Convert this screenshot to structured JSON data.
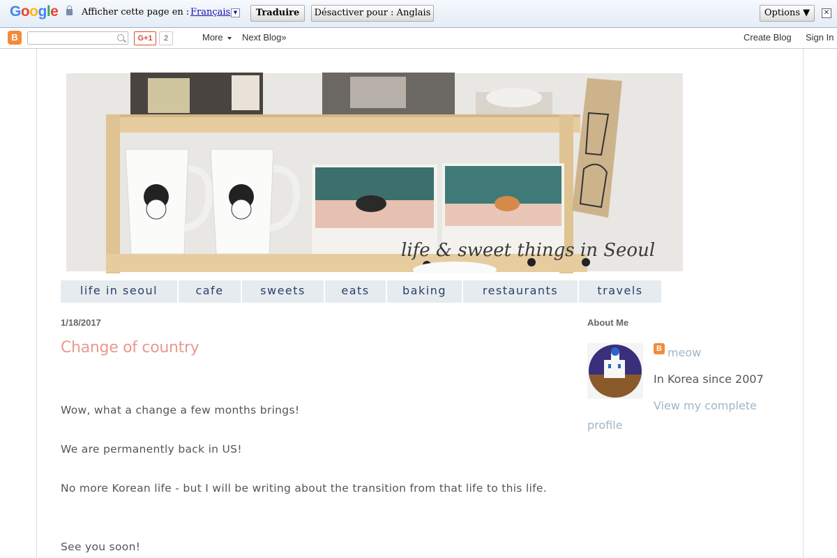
{
  "translate_bar": {
    "label": "Afficher cette page en :",
    "language": "Français",
    "translate_button": "Traduire",
    "disable_button": "Désactiver pour : Anglais",
    "options_button": "Options ▼",
    "close_glyph": "✕"
  },
  "navbar": {
    "gplus_label": "G+1",
    "gplus_count": "2",
    "more": "More",
    "next_blog": "Next Blog»",
    "create_blog": "Create Blog",
    "sign_in": "Sign In"
  },
  "header": {
    "title": "life & sweet things in Seoul"
  },
  "tabs": [
    "life in seoul",
    "cafe",
    "sweets",
    "eats",
    "baking",
    "restaurants",
    "travels"
  ],
  "post": {
    "date": "1/18/2017",
    "title": "Change of country",
    "paragraphs": [
      "Wow, what a change a few months brings!",
      "We are permanently back in US!",
      "No more Korean life - but I will be writing about the transition from that life to this life.",
      "See you soon!"
    ]
  },
  "sidebar": {
    "about_title": "About Me",
    "profile_name": "meow",
    "profile_desc": "In Korea since 2007",
    "profile_link_line1": "View my complete",
    "profile_link_line2": "profile"
  }
}
